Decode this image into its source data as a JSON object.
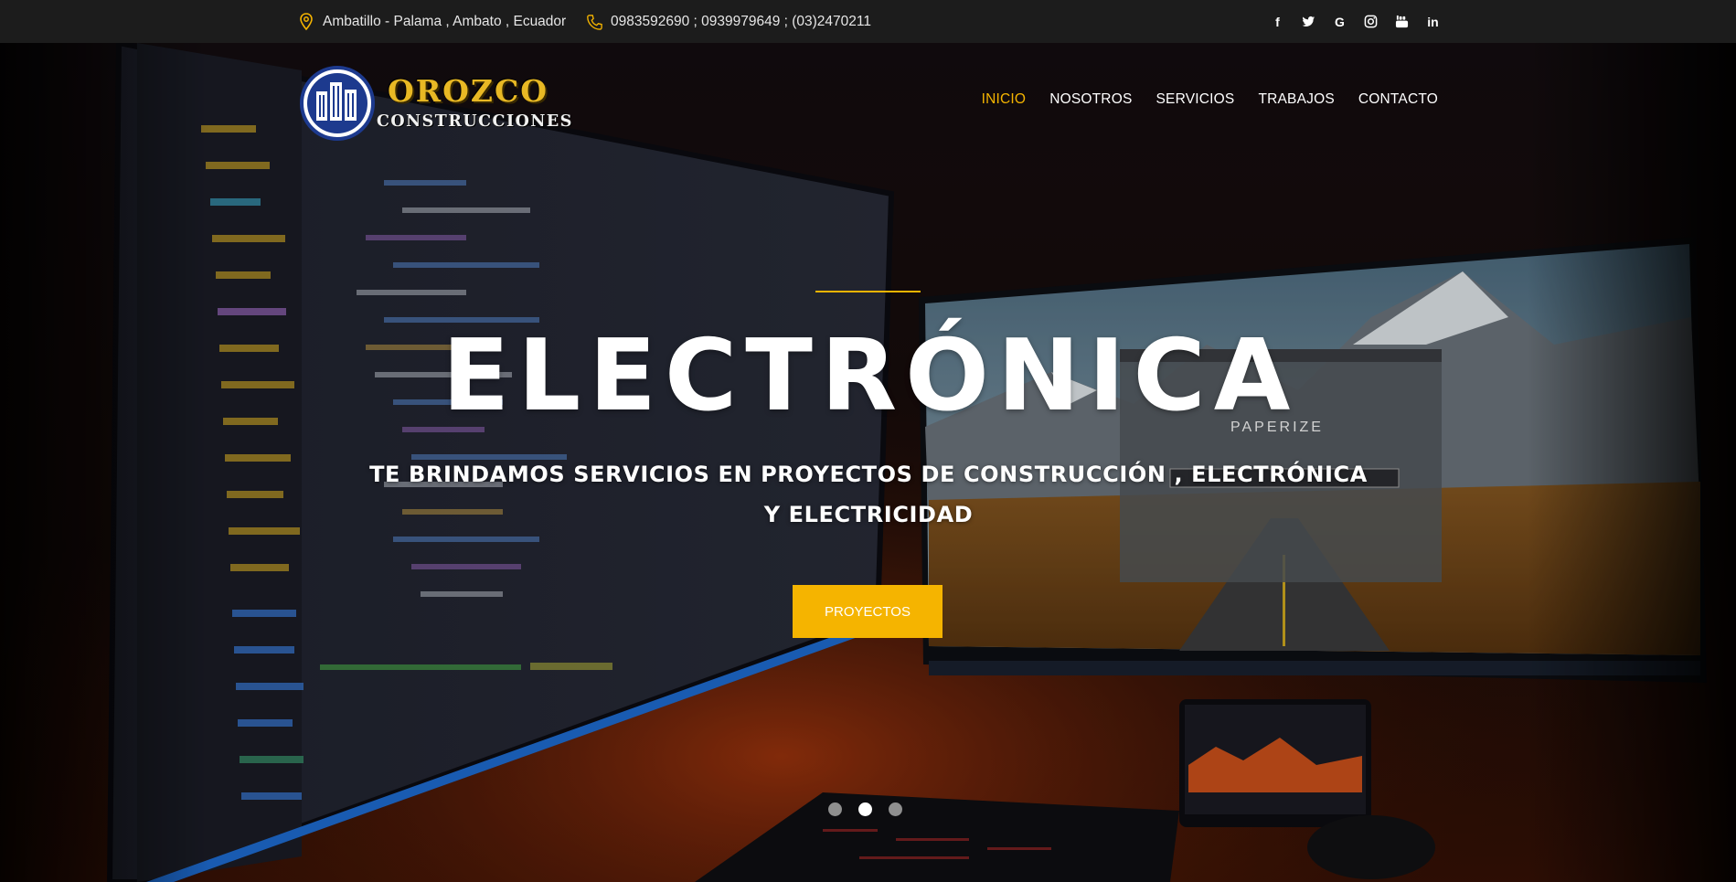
{
  "topbar": {
    "address": "Ambatillo - Palama , Ambato , Ecuador",
    "phones": "0983592690 ; 0939979649 ; (03)2470211",
    "social": [
      "facebook-icon",
      "twitter-icon",
      "google-icon",
      "instagram-icon",
      "youtube-icon",
      "linkedin-icon"
    ]
  },
  "logo": {
    "line1": "OROZCO",
    "line2": "CONSTRUCCIONES"
  },
  "nav": [
    {
      "label": "INICIO",
      "active": true
    },
    {
      "label": "NOSOTROS"
    },
    {
      "label": "SERVICIOS"
    },
    {
      "label": "TRABAJOS"
    },
    {
      "label": "CONTACTO"
    }
  ],
  "hero": {
    "title": "ELECTRÓNICA",
    "subtitle": "TE BRINDAMOS SERVICIOS EN PROYECTOS DE CONSTRUCCIÓN , ELECTRÓNICA Y ELECTRICIDAD",
    "cta": "PROYECTOS",
    "screen_label": "PAPERIZE",
    "slides": 3,
    "active_slide": 2
  },
  "colors": {
    "accent": "#f5b400",
    "topbar": "#1c1c1c",
    "logo_blue": "#1d3a8e"
  }
}
